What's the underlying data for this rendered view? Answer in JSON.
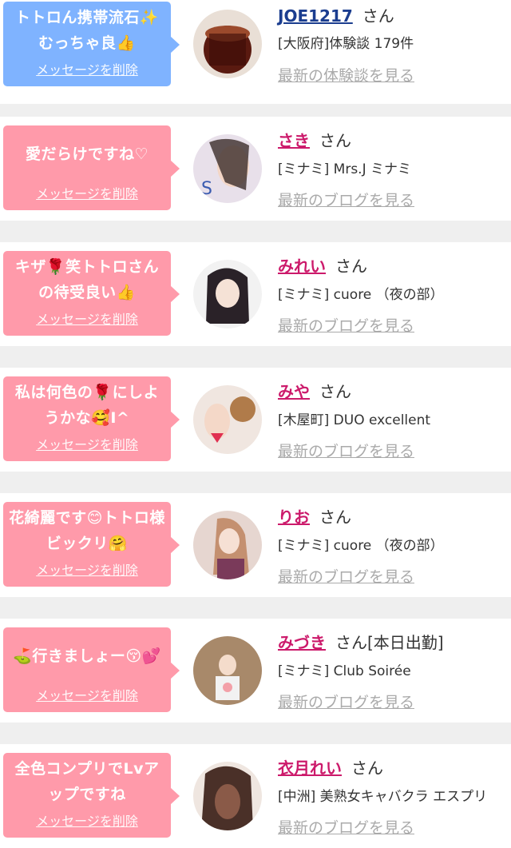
{
  "items": [
    {
      "message": "トトロん携帯流石✨むっちゃ良👍",
      "delete_label": "メッセージを削除",
      "name": "JOE1217",
      "suffix": "さん",
      "info": "[大阪府]体験談 179件",
      "link": "最新の体験談を見る",
      "theme": "blue"
    },
    {
      "message": "愛だらけですね♡",
      "delete_label": "メッセージを削除",
      "name": "さき",
      "suffix": "さん",
      "info": "[ミナミ] Mrs.J ミナミ",
      "link": "最新のブログを見る",
      "theme": "pink"
    },
    {
      "message": "キザ🌹笑トトロさんの待受良い👍",
      "delete_label": "メッセージを削除",
      "name": "みれい",
      "suffix": "さん",
      "info": "[ミナミ] cuore （夜の部）",
      "link": "最新のブログを見る",
      "theme": "pink"
    },
    {
      "message": "私は何色の🌹にしようかな🥰I^",
      "delete_label": "メッセージを削除",
      "name": "みや",
      "suffix": "さん",
      "info": "[木屋町] DUO excellent",
      "link": "最新のブログを見る",
      "theme": "pink"
    },
    {
      "message": "花綺麗です😊トトロ様ビックリ🤗",
      "delete_label": "メッセージを削除",
      "name": "りお",
      "suffix": "さん",
      "info": "[ミナミ] cuore （夜の部）",
      "link": "最新のブログを見る",
      "theme": "pink"
    },
    {
      "message": "⛳行きましょー😚💕",
      "delete_label": "メッセージを削除",
      "name": "みづき",
      "suffix": "さん[本日出勤]",
      "info": "[ミナミ] Club Soirée",
      "link": "最新のブログを見る",
      "theme": "pink"
    },
    {
      "message": "全色コンプリでLvアップですね",
      "delete_label": "メッセージを削除",
      "name": "衣月れい",
      "suffix": "さん",
      "info": "[中洲] 美熟女キャバクラ エスプリ",
      "link": "最新のブログを見る",
      "theme": "pink"
    }
  ],
  "colors": {
    "blue_bubble": "#7fb3ff",
    "pink_bubble": "#ff9aaa",
    "pink_name": "#cc1a6b",
    "blue_name": "#1b3d8f",
    "link_gray": "#aaaaaa"
  }
}
